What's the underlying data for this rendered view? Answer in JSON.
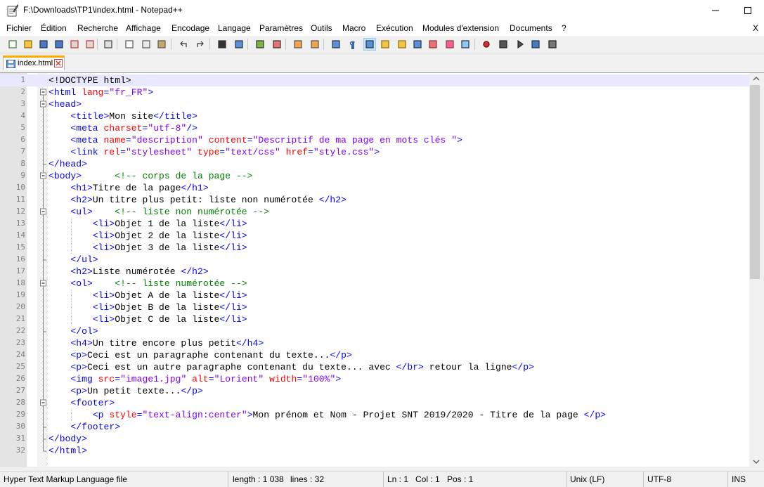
{
  "window": {
    "title": "F:\\Downloads\\TP1\\index.html - Notepad++"
  },
  "menu": [
    {
      "label": "Fichier"
    },
    {
      "label": "Édition"
    },
    {
      "label": "Recherche"
    },
    {
      "label": "Affichage"
    },
    {
      "label": "Encodage"
    },
    {
      "label": "Langage"
    },
    {
      "label": "Paramètres"
    },
    {
      "label": "Outils"
    },
    {
      "label": "Macro"
    },
    {
      "label": "Exécution"
    },
    {
      "label": "Modules d'extension"
    },
    {
      "label": "Documents"
    },
    {
      "label": "?"
    }
  ],
  "menu_close": "X",
  "tab": {
    "label": "index.html"
  },
  "editor": {
    "current_line": 1,
    "lines": [
      [
        [
          "doc",
          "<!DOCTYPE html>"
        ]
      ],
      [
        [
          "tag",
          "<html "
        ],
        [
          "attr",
          "lang"
        ],
        [
          "tag",
          "="
        ],
        [
          "str",
          "\"fr_FR\""
        ],
        [
          "tag",
          ">"
        ]
      ],
      [
        [
          "tag",
          "<head>"
        ]
      ],
      [
        [
          "pad",
          "    "
        ],
        [
          "tag",
          "<title>"
        ],
        [
          "txt",
          "Mon site"
        ],
        [
          "tag",
          "</title>"
        ]
      ],
      [
        [
          "pad",
          "    "
        ],
        [
          "tag",
          "<meta "
        ],
        [
          "attr",
          "charset"
        ],
        [
          "tag",
          "="
        ],
        [
          "str",
          "\"utf-8\""
        ],
        [
          "tag",
          "/>"
        ]
      ],
      [
        [
          "pad",
          "    "
        ],
        [
          "tag",
          "<meta "
        ],
        [
          "attr",
          "name"
        ],
        [
          "tag",
          "="
        ],
        [
          "str",
          "\"description\""
        ],
        [
          "tag",
          " "
        ],
        [
          "attr",
          "content"
        ],
        [
          "tag",
          "="
        ],
        [
          "str",
          "\"Descriptif de ma page en mots clés \""
        ],
        [
          "tag",
          ">"
        ]
      ],
      [
        [
          "pad",
          "    "
        ],
        [
          "tag",
          "<link "
        ],
        [
          "attr",
          "rel"
        ],
        [
          "tag",
          "="
        ],
        [
          "str",
          "\"stylesheet\""
        ],
        [
          "tag",
          " "
        ],
        [
          "attr",
          "type"
        ],
        [
          "tag",
          "="
        ],
        [
          "str",
          "\"text/css\""
        ],
        [
          "tag",
          " "
        ],
        [
          "attr",
          "href"
        ],
        [
          "tag",
          "="
        ],
        [
          "str",
          "\"style.css\""
        ],
        [
          "tag",
          ">"
        ]
      ],
      [
        [
          "tag",
          "</head>"
        ]
      ],
      [
        [
          "tag",
          "<body>"
        ],
        [
          "pad",
          "      "
        ],
        [
          "com",
          "<!-- corps de la page -->"
        ]
      ],
      [
        [
          "pad",
          "    "
        ],
        [
          "tag",
          "<h1>"
        ],
        [
          "txt",
          "Titre de la page"
        ],
        [
          "tag",
          "</h1>"
        ]
      ],
      [
        [
          "pad",
          "    "
        ],
        [
          "tag",
          "<h2>"
        ],
        [
          "txt",
          "Un titre plus petit: liste non numérotée "
        ],
        [
          "tag",
          "</h2>"
        ]
      ],
      [
        [
          "pad",
          "    "
        ],
        [
          "tag",
          "<ul>"
        ],
        [
          "pad",
          "    "
        ],
        [
          "com",
          "<!-- liste non numérotée -->"
        ]
      ],
      [
        [
          "pad",
          "        "
        ],
        [
          "tag",
          "<li>"
        ],
        [
          "txt",
          "Objet 1 de la liste"
        ],
        [
          "tag",
          "</li>"
        ]
      ],
      [
        [
          "pad",
          "        "
        ],
        [
          "tag",
          "<li>"
        ],
        [
          "txt",
          "Objet 2 de la liste"
        ],
        [
          "tag",
          "</li>"
        ]
      ],
      [
        [
          "pad",
          "        "
        ],
        [
          "tag",
          "<li>"
        ],
        [
          "txt",
          "Objet 3 de la liste"
        ],
        [
          "tag",
          "</li>"
        ]
      ],
      [
        [
          "pad",
          "    "
        ],
        [
          "tag",
          "</ul>"
        ]
      ],
      [
        [
          "pad",
          "    "
        ],
        [
          "tag",
          "<h2>"
        ],
        [
          "txt",
          "Liste numérotée "
        ],
        [
          "tag",
          "</h2>"
        ]
      ],
      [
        [
          "pad",
          "    "
        ],
        [
          "tag",
          "<ol>"
        ],
        [
          "pad",
          "    "
        ],
        [
          "com",
          "<!-- liste numérotée -->"
        ]
      ],
      [
        [
          "pad",
          "        "
        ],
        [
          "tag",
          "<li>"
        ],
        [
          "txt",
          "Objet A de la liste"
        ],
        [
          "tag",
          "</li>"
        ]
      ],
      [
        [
          "pad",
          "        "
        ],
        [
          "tag",
          "<li>"
        ],
        [
          "txt",
          "Objet B de la liste"
        ],
        [
          "tag",
          "</li>"
        ]
      ],
      [
        [
          "pad",
          "        "
        ],
        [
          "tag",
          "<li>"
        ],
        [
          "txt",
          "Objet C de la liste"
        ],
        [
          "tag",
          "</li>"
        ]
      ],
      [
        [
          "pad",
          "    "
        ],
        [
          "tag",
          "</ol>"
        ]
      ],
      [
        [
          "pad",
          "    "
        ],
        [
          "tag",
          "<h4>"
        ],
        [
          "txt",
          "Un titre encore plus petit"
        ],
        [
          "tag",
          "</h4>"
        ]
      ],
      [
        [
          "pad",
          "    "
        ],
        [
          "tag",
          "<p>"
        ],
        [
          "txt",
          "Ceci est un paragraphe contenant du texte..."
        ],
        [
          "tag",
          "</p>"
        ]
      ],
      [
        [
          "pad",
          "    "
        ],
        [
          "tag",
          "<p>"
        ],
        [
          "txt",
          "Ceci est un autre paragraphe contenant du texte... avec "
        ],
        [
          "tag",
          "</br>"
        ],
        [
          "txt",
          " retour la ligne"
        ],
        [
          "tag",
          "</p>"
        ]
      ],
      [
        [
          "pad",
          "    "
        ],
        [
          "tag",
          "<img "
        ],
        [
          "attr",
          "src"
        ],
        [
          "tag",
          "="
        ],
        [
          "str",
          "\"image1.jpg\""
        ],
        [
          "tag",
          " "
        ],
        [
          "attr",
          "alt"
        ],
        [
          "tag",
          "="
        ],
        [
          "str",
          "\"Lorient\""
        ],
        [
          "tag",
          " "
        ],
        [
          "attr",
          "width"
        ],
        [
          "tag",
          "="
        ],
        [
          "str",
          "\"100%\""
        ],
        [
          "tag",
          ">"
        ]
      ],
      [
        [
          "pad",
          "    "
        ],
        [
          "tag",
          "<p>"
        ],
        [
          "txt",
          "Un petit texte..."
        ],
        [
          "tag",
          "</p>"
        ]
      ],
      [
        [
          "pad",
          "    "
        ],
        [
          "tag",
          "<footer>"
        ]
      ],
      [
        [
          "pad",
          "        "
        ],
        [
          "tag",
          "<p "
        ],
        [
          "attr",
          "style"
        ],
        [
          "tag",
          "="
        ],
        [
          "str",
          "\"text-align:center\""
        ],
        [
          "tag",
          ">"
        ],
        [
          "txt",
          "Mon prénom et Nom - Projet SNT 2019/2020 - Titre de la page "
        ],
        [
          "tag",
          "</p>"
        ]
      ],
      [
        [
          "pad",
          "    "
        ],
        [
          "tag",
          "</footer>"
        ]
      ],
      [
        [
          "tag",
          "</body>"
        ]
      ],
      [
        [
          "tag",
          "</html>"
        ]
      ]
    ]
  },
  "status": {
    "file_type": "Hyper Text Markup Language file",
    "length": "length : 1 038",
    "lines": "lines : 32",
    "ln": "Ln : 1",
    "col": "Col : 1",
    "pos": "Pos : 1",
    "eol": "Unix (LF)",
    "encoding": "UTF-8",
    "mode": "INS"
  }
}
